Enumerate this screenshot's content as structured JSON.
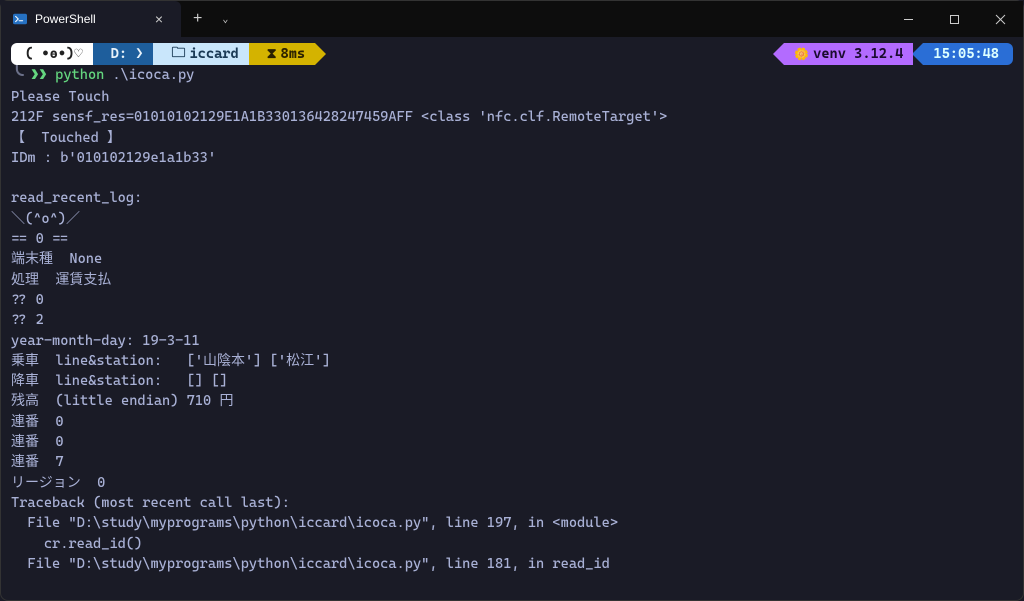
{
  "window": {
    "tab_title": "PowerShell",
    "new_tab": "+",
    "dropdown": "⌄",
    "minimize": "—",
    "maximize": "□",
    "close": "✕"
  },
  "prompt": {
    "face": "( •ө•)♡",
    "drive": "D:",
    "drive_sep": "❭",
    "folder_icon": "🗀",
    "folder": "iccard",
    "hourglass_icon": "⧗",
    "timing": "8ms",
    "venv_icon": "🌼",
    "venv": "venv 3.12.4",
    "clock": "15:05:48"
  },
  "command": {
    "bracket": "╰",
    "chevrons": "❯❯",
    "bin": "python",
    "arg": ".\\icoca.py"
  },
  "output_lines": [
    "Please Touch",
    "212F sensf_res=01010102129E1A1B330136428247459AFF <class 'nfc.clf.RemoteTarget'>",
    "【  Touched 】",
    "IDm : b'010102129e1a1b33'",
    "",
    "read_recent_log:",
    "＼(^o^)／",
    "== 0 ==",
    "端末種  None",
    "処理  運賃支払",
    "?? 0",
    "?? 2",
    "year-month-day: 19-3-11",
    "乗車  line&station:   ['山陰本'] ['松江']",
    "降車  line&station:   [] []",
    "残高  (little endian) 710 円",
    "連番  0",
    "連番  0",
    "連番  7",
    "リージョン  0",
    "Traceback (most recent call last):",
    "  File \"D:\\study\\myprograms\\python\\iccard\\icoca.py\", line 197, in <module>",
    "    cr.read_id()",
    "  File \"D:\\study\\myprograms\\python\\iccard\\icoca.py\", line 181, in read_id"
  ]
}
